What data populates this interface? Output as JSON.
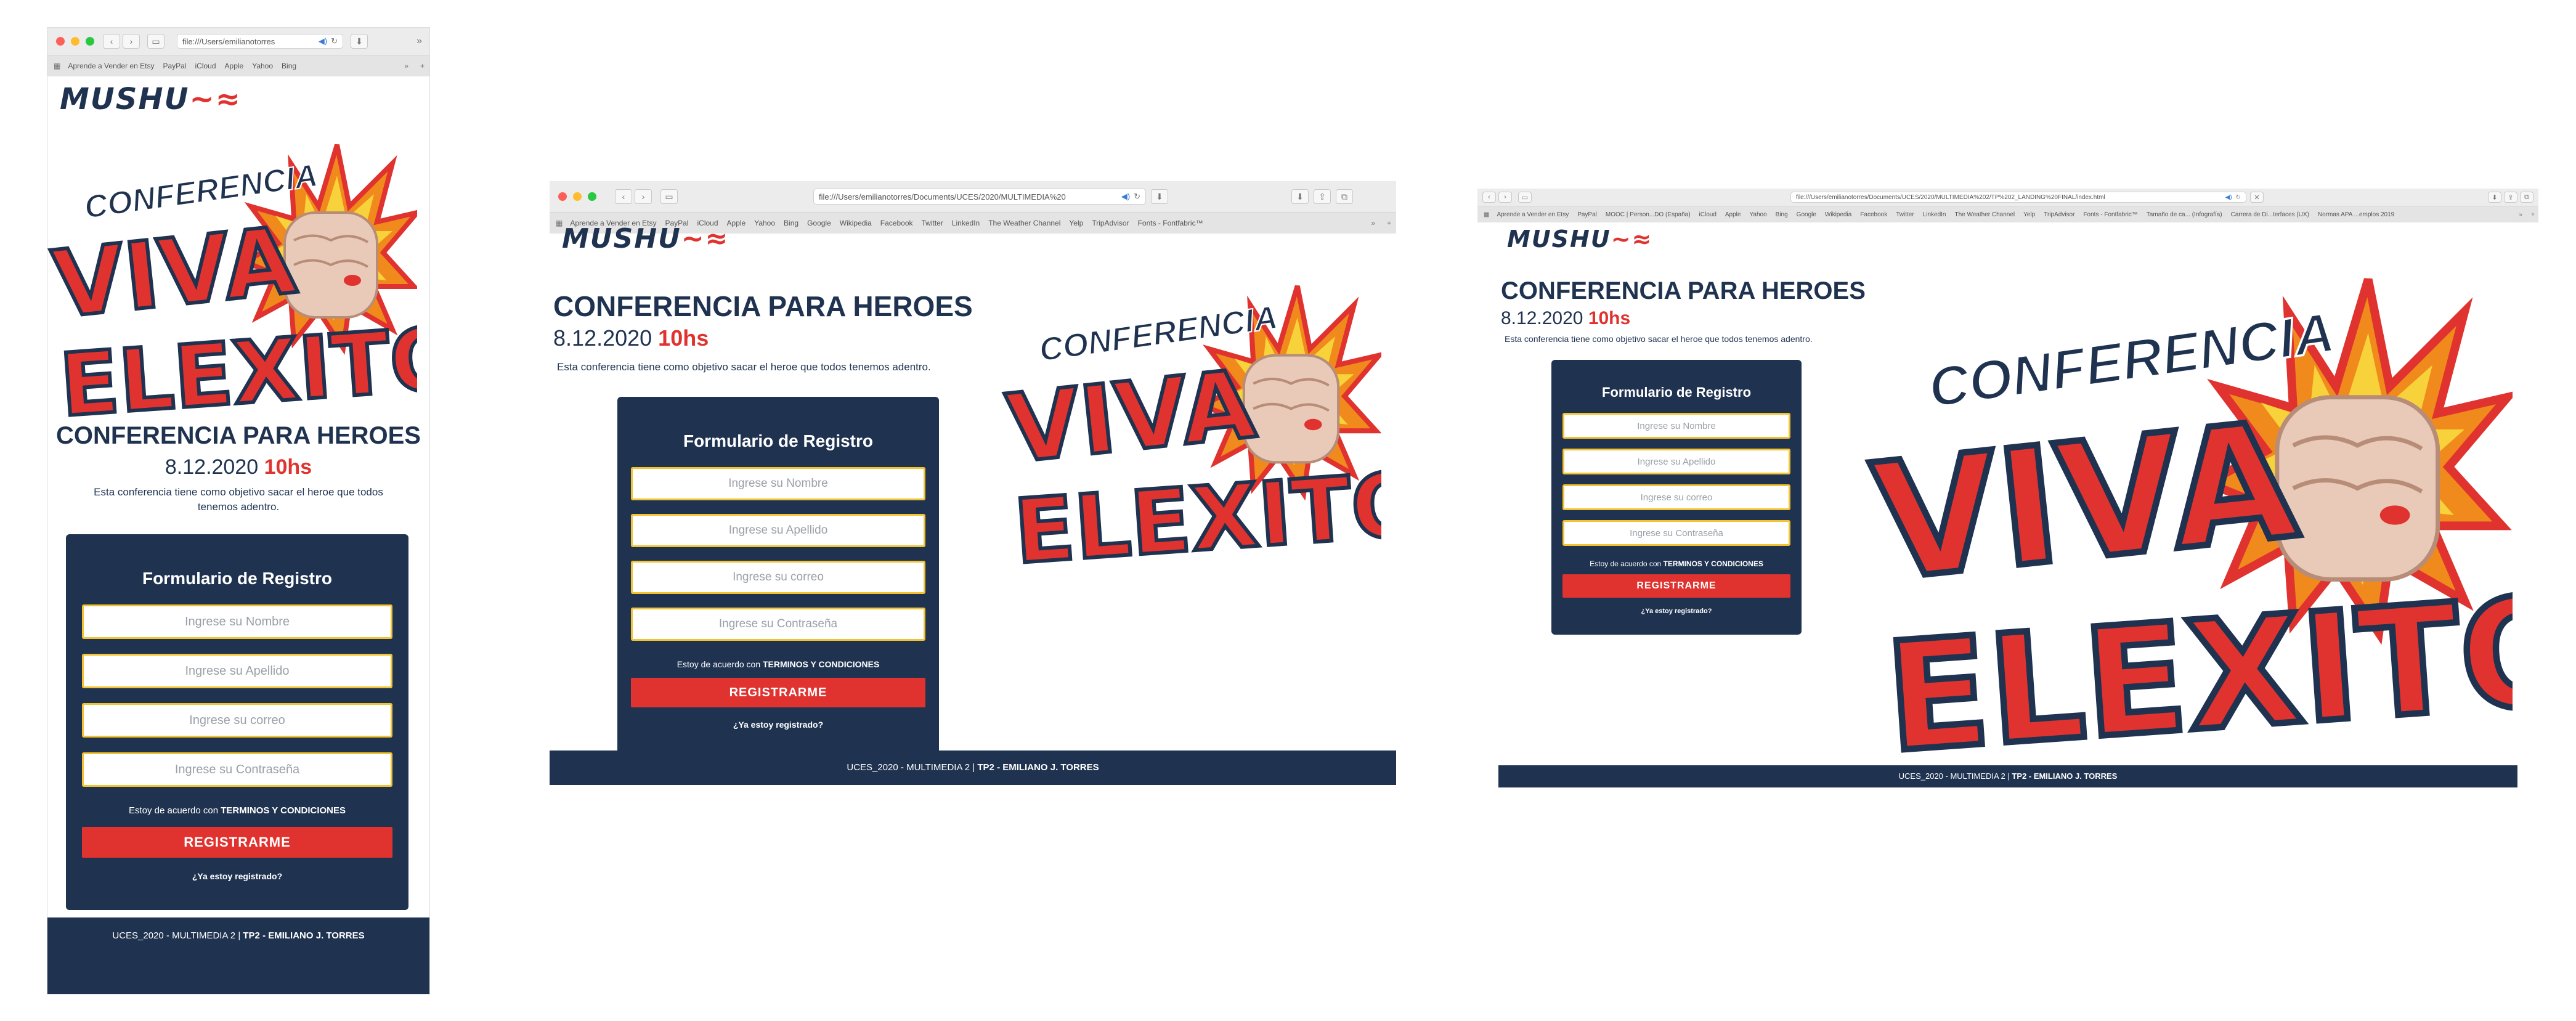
{
  "browser": {
    "url_mobile": "file:///Users/emilianotorres",
    "url_tablet": "file:///Users/emilianotorres/Documents/UCES/2020/MULTIMEDIA%20",
    "url_desktop": "file:///Users/emilianotorres/Documents/UCES/2020/MULTIMEDIA%202/TP%202_LANDING%20FINAL/index.html",
    "favorites_mobile": [
      "Aprende a Vender en Etsy",
      "PayPal",
      "iCloud",
      "Apple",
      "Yahoo",
      "Bing"
    ],
    "favorites_tablet": [
      "Aprende a Vender en Etsy",
      "PayPal",
      "iCloud",
      "Apple",
      "Yahoo",
      "Bing",
      "Google",
      "Wikipedia",
      "Facebook",
      "Twitter",
      "LinkedIn",
      "The Weather Channel",
      "Yelp",
      "TripAdvisor",
      "Fonts - Fontfabric™"
    ],
    "favorites_desktop": [
      "Aprende a Vender en Etsy",
      "PayPal",
      "MOOC | Person...DO (España)",
      "iCloud",
      "Apple",
      "Yahoo",
      "Bing",
      "Google",
      "Wikipedia",
      "Facebook",
      "Twitter",
      "LinkedIn",
      "The Weather Channel",
      "Yelp",
      "TripAdvisor",
      "Fonts - Fontfabric™",
      "Tamaño de ca... (Infografía)",
      "Carrera de Di...terfaces (UX)",
      "Normas APA ...emplos 2019"
    ],
    "more": ">>"
  },
  "brand": {
    "logo_text": "MUSHU"
  },
  "hero": {
    "line1": "CONFERENCIA",
    "line2": "VIVA",
    "line3": "ELEXITO"
  },
  "page": {
    "title": "CONFERENCIA PARA HEROES",
    "date": "8.12.2020",
    "time": "10hs",
    "description": "Esta conferencia tiene como objetivo sacar el heroe que todos tenemos adentro."
  },
  "form": {
    "title": "Formulario de Registro",
    "name_placeholder": "Ingrese su Nombre",
    "surname_placeholder": "Ingrese su Apellido",
    "email_placeholder": "Ingrese su correo",
    "password_placeholder": "Ingrese su Contraseña",
    "terms_prefix": "Estoy de acuerdo con",
    "terms_link": "TERMINOS Y CONDICIONES",
    "submit": "REGISTRARME",
    "already": "¿Ya estoy registrado?"
  },
  "footer": {
    "course": "UCES_2020 - MULTIMEDIA 2 |",
    "author": "TP2 - EMILIANO J. TORRES"
  },
  "colors": {
    "navy": "#1f3350",
    "red": "#e0332f",
    "yellow": "#f2c230",
    "burst_orange": "#f08a1c"
  }
}
